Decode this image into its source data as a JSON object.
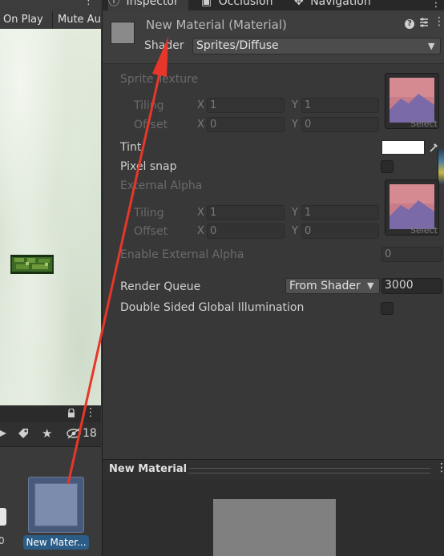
{
  "scene": {
    "tabs": [
      "On Play",
      "Mute Au"
    ],
    "more_icon": "kebab-menu-icon"
  },
  "project": {
    "hidden_count": "18",
    "zero_label": "0",
    "selected_asset_label": "New Mater..."
  },
  "inspector": {
    "tabs": [
      "Inspector",
      "Occlusion",
      "Navigation"
    ],
    "material_title": "New Material (Material)",
    "shader_label": "Shader",
    "shader_value": "Sprites/Diffuse",
    "props": {
      "sprite_texture": "Sprite Texture",
      "tiling": "Tiling",
      "offset": "Offset",
      "x": "X",
      "y": "Y",
      "tiling_x": "1",
      "tiling_y": "1",
      "offset_x": "0",
      "offset_y": "0",
      "select": "Select",
      "tint": "Tint",
      "pixel_snap": "Pixel snap",
      "external_alpha": "External Alpha",
      "ext_tiling_x": "1",
      "ext_tiling_y": "1",
      "ext_offset_x": "0",
      "ext_offset_y": "0",
      "enable_external_alpha": "Enable External Alpha",
      "enable_external_alpha_value": "0",
      "render_queue": "Render Queue",
      "render_queue_mode": "From Shader",
      "render_queue_value": "3000",
      "double_sided_gi": "Double Sided Global Illumination"
    },
    "preview_title": "New Material"
  },
  "colors": {
    "annotation_arrow": "#e8362a",
    "selection_blue": "#2c5d87",
    "tint_color": "#ffffff"
  }
}
